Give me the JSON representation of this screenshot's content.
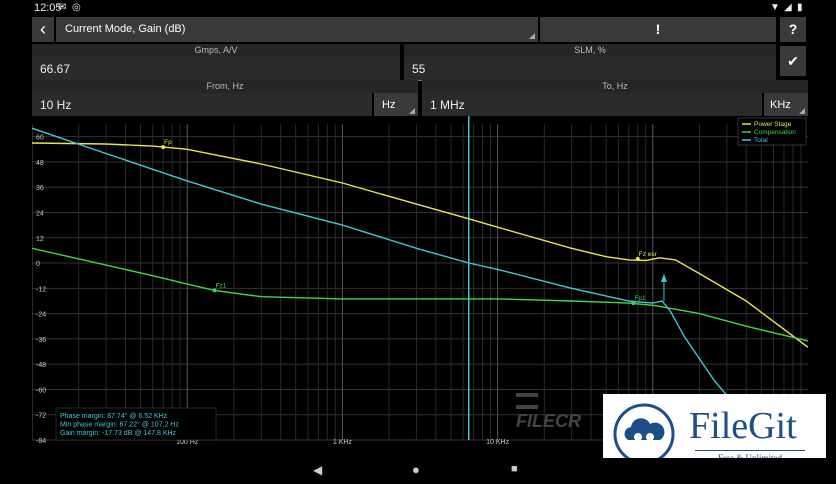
{
  "status": {
    "time": "12:05",
    "icons": [
      "mail-icon",
      "at-icon",
      "wifi-icon",
      "signal-icon",
      "battery-icon"
    ]
  },
  "toolbar": {
    "back_glyph": "‹",
    "title": "Current Mode, Gain (dB)",
    "alert_glyph": "!",
    "help_glyph": "?"
  },
  "params": {
    "gmps_label": "Gmps, A/V",
    "gmps_value": "66.67",
    "slm_label": "SLM, %",
    "slm_value": "55",
    "from_label": "From, Hz",
    "from_value": "10 Hz",
    "from_unit": "Hz",
    "to_label": "To, Hz",
    "to_value": "1 MHz",
    "to_unit": "KHz"
  },
  "chart_data": {
    "type": "line",
    "xscale": "log",
    "xlim": [
      10,
      1000000
    ],
    "ylim": [
      -84,
      66
    ],
    "yticks": [
      60,
      48,
      36,
      24,
      12,
      0,
      -12,
      -24,
      -36,
      -48,
      -60,
      -72,
      -84
    ],
    "xtick_labels": [
      {
        "x": 100,
        "label": "100 Hz"
      },
      {
        "x": 1000,
        "label": "1 KHz"
      },
      {
        "x": 10000,
        "label": "10 KHz"
      }
    ],
    "grid": true,
    "legend_position": "top-right",
    "cursor_x": 6520,
    "series": [
      {
        "name": "Power Stage",
        "color": "#e8e64a",
        "x": [
          10,
          30,
          60,
          100,
          300,
          1000,
          3000,
          6520,
          10000,
          30000,
          50000,
          70000,
          90000,
          110000,
          140000,
          200000,
          400000,
          1000000
        ],
        "y": [
          57,
          56.5,
          55.5,
          54,
          47,
          38,
          28,
          21,
          17,
          7,
          3,
          1.5,
          1.2,
          2.5,
          1.5,
          -5,
          -18,
          -40
        ]
      },
      {
        "name": "Compensation",
        "color": "#3fd64a",
        "x": [
          10,
          30,
          60,
          100,
          150,
          300,
          1000,
          3000,
          10000,
          30000,
          70000,
          100000,
          200000,
          400000,
          1000000
        ],
        "y": [
          7,
          -1,
          -6,
          -10,
          -13,
          -16,
          -17,
          -17,
          -17,
          -18,
          -19,
          -20,
          -24,
          -30,
          -37
        ]
      },
      {
        "name": "Total",
        "color": "#46c6d4",
        "x": [
          10,
          30,
          100,
          300,
          1000,
          3000,
          6520,
          10000,
          30000,
          70000,
          100000,
          115000,
          130000,
          160000,
          250000,
          500000
        ],
        "y": [
          64,
          52,
          39,
          28,
          18,
          7,
          0,
          -3,
          -12,
          -18,
          -19,
          -18,
          -23,
          -35,
          -56,
          -82
        ]
      }
    ],
    "markers": [
      {
        "label": "Fp",
        "x": 70,
        "y": 55
      },
      {
        "label": "Fz1",
        "x": 150,
        "y": -13
      },
      {
        "label": "Fp1",
        "x": 75000,
        "y": -19
      },
      {
        "label": "Fz esr",
        "x": 80000,
        "y": 2
      }
    ],
    "annotations": [
      "Phase margin: 87.74° @ 6.52 KHz",
      "Min phase margin: 67.22° @ 107.2 Hz",
      "Gain margin: -17.73 dB @ 147.8 KHz"
    ]
  },
  "watermark": {
    "text": "FILECR",
    "brand": "FileGit",
    "tagline": "Free & Unlimited"
  },
  "nav": {
    "back": "◀",
    "home": "●",
    "recent": "■"
  }
}
